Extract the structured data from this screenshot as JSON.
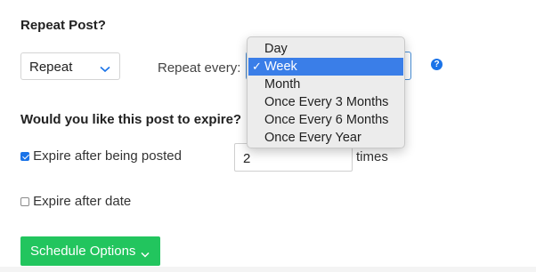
{
  "repeat_section": {
    "heading": "Repeat Post?",
    "select_value": "Repeat",
    "repeat_every_label": "Repeat every:",
    "help_icon_glyph": "?"
  },
  "dropdown": {
    "selected_mark": "✓",
    "options": [
      "Day",
      "Week",
      "Month",
      "Once Every 3 Months",
      "Once Every 6 Months",
      "Once Every Year"
    ],
    "selected": "Week"
  },
  "expire_section": {
    "heading": "Would you like this post to expire?",
    "after_posted_label": "Expire after being posted",
    "after_posted_checked": true,
    "times_value": "2",
    "times_label": "times",
    "after_date_label": "Expire after date",
    "after_date_checked": false
  },
  "schedule_button": {
    "label": "Schedule Options"
  },
  "colors": {
    "accent_blue": "#1a73e8",
    "button_green": "#22c55e",
    "menu_highlight": "#3a7ee8"
  }
}
